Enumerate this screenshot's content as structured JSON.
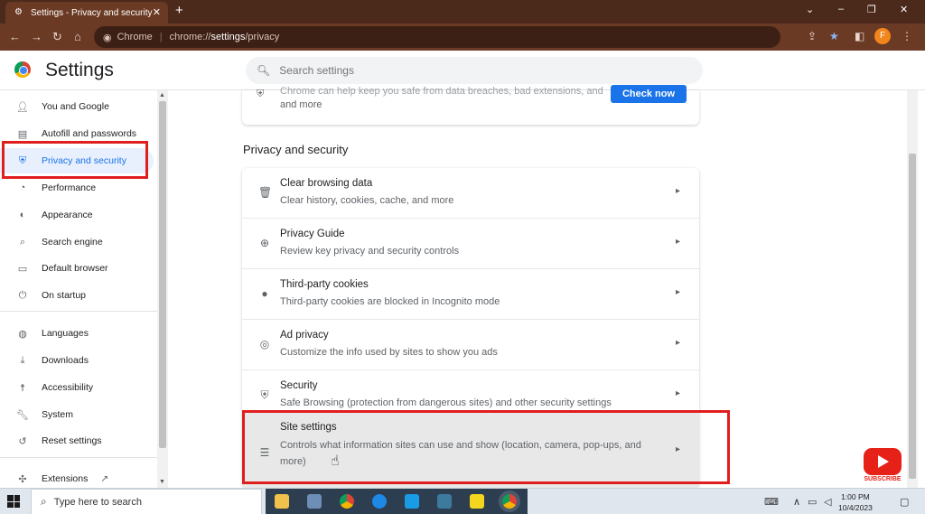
{
  "browser": {
    "tab_title": "Settings - Privacy and security",
    "tab_close": "✕",
    "new_tab": "+",
    "win_min": "⌄",
    "win_minimize": "–",
    "win_restore": "❐",
    "win_close": "✕",
    "omnibox_site": "Chrome",
    "omnibox_url_prefix": "chrome://",
    "omnibox_url_bold": "settings",
    "omnibox_url_suffix": "/privacy",
    "profile_initial": "F"
  },
  "header": {
    "title": "Settings",
    "search_placeholder": "Search settings"
  },
  "sidebar": {
    "items": [
      {
        "label": "You and Google",
        "icon": "person-icon"
      },
      {
        "label": "Autofill and passwords",
        "icon": "clipboard-icon"
      },
      {
        "label": "Privacy and security",
        "icon": "shield-icon"
      },
      {
        "label": "Performance",
        "icon": "speedometer-icon"
      },
      {
        "label": "Appearance",
        "icon": "palette-icon"
      },
      {
        "label": "Search engine",
        "icon": "search-icon"
      },
      {
        "label": "Default browser",
        "icon": "browser-icon"
      },
      {
        "label": "On startup",
        "icon": "power-icon"
      },
      {
        "label": "Languages",
        "icon": "globe-icon"
      },
      {
        "label": "Downloads",
        "icon": "download-icon"
      },
      {
        "label": "Accessibility",
        "icon": "accessibility-icon"
      },
      {
        "label": "System",
        "icon": "wrench-icon"
      },
      {
        "label": "Reset settings",
        "icon": "reset-icon"
      },
      {
        "label": "Extensions",
        "icon": "puzzle-icon"
      }
    ]
  },
  "main": {
    "top_card_line1": "Chrome can help keep you safe from data breaches, bad extensions, and",
    "top_card_line2": "and more",
    "check_now": "Check now",
    "section_title": "Privacy and security",
    "rows": [
      {
        "title": "Clear browsing data",
        "desc": "Clear history, cookies, cache, and more",
        "icon": "trash-icon"
      },
      {
        "title": "Privacy Guide",
        "desc": "Review key privacy and security controls",
        "icon": "compass-icon"
      },
      {
        "title": "Third-party cookies",
        "desc": "Third-party cookies are blocked in Incognito mode",
        "icon": "cookie-icon"
      },
      {
        "title": "Ad privacy",
        "desc": "Customize the info used by sites to show you ads",
        "icon": "ad-privacy-icon"
      },
      {
        "title": "Security",
        "desc": "Safe Browsing (protection from dangerous sites) and other security settings",
        "icon": "shield-icon"
      },
      {
        "title": "Site settings",
        "desc": "Controls what information sites can use and show (location, camera, pop-ups, and more)",
        "icon": "sliders-icon"
      }
    ]
  },
  "overlay": {
    "subscribe": "SUBSCRIBE"
  },
  "taskbar": {
    "search_placeholder": "Type here to search",
    "time": "1:00 PM",
    "date": "10/4/2023"
  },
  "colors": {
    "accent": "#1a73e8",
    "highlight_box": "#e01e1e",
    "titlebar": "#4b2a1c"
  }
}
